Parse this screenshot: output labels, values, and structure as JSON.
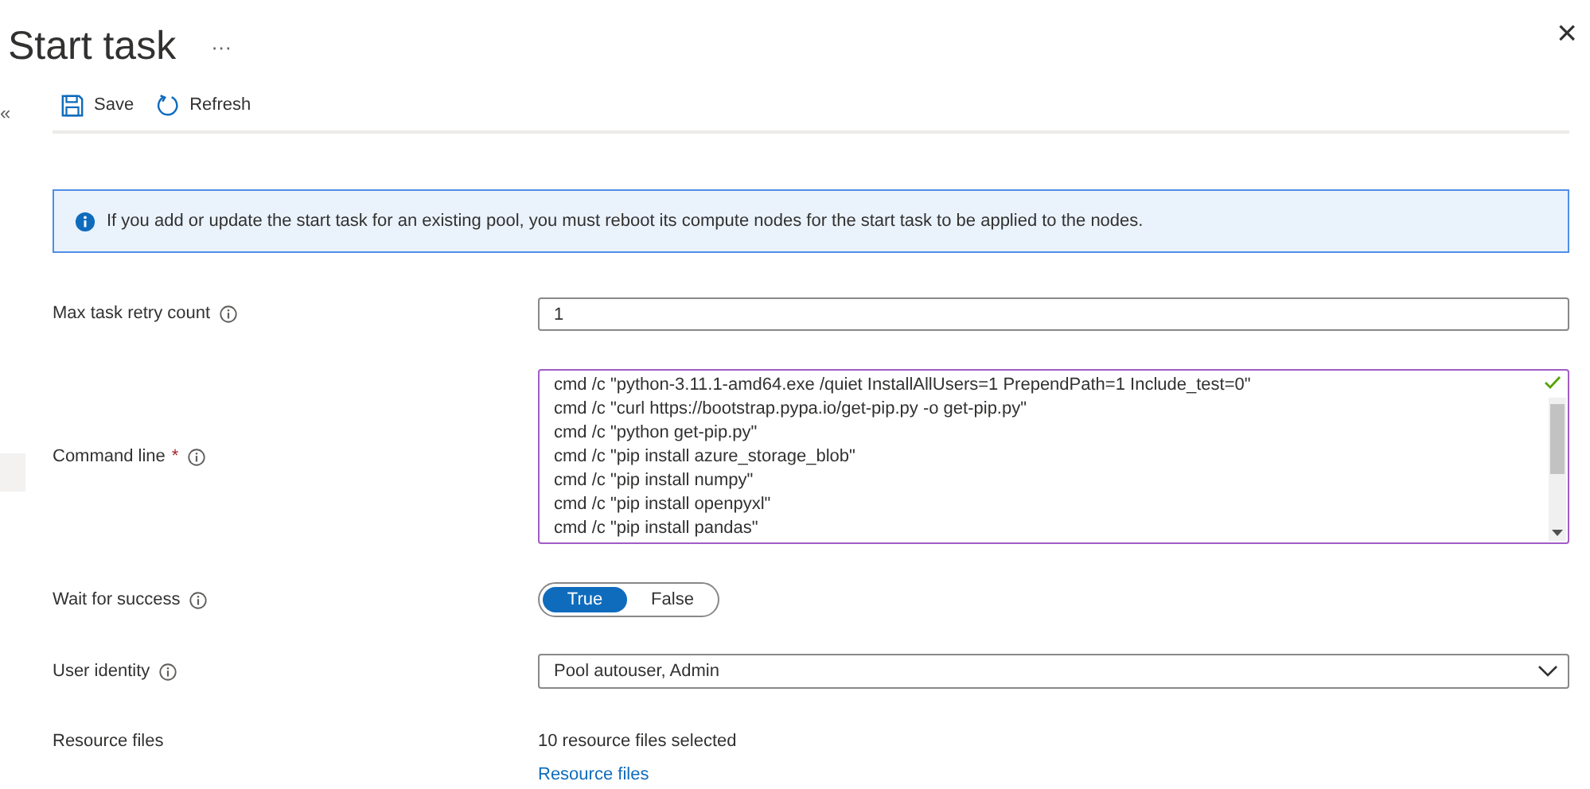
{
  "header": {
    "title": "Start task",
    "more": "···",
    "close": "×"
  },
  "sidebar": {
    "collapse": "«"
  },
  "toolbar": [
    {
      "label": "Save",
      "kind": "save"
    },
    {
      "label": "Refresh",
      "kind": "refresh"
    }
  ],
  "info": "If you add or update the start task for an existing pool, you must reboot its compute nodes for the start task to be applied to the nodes.",
  "fields": [
    {
      "label": "Max task retry count",
      "kind": "text",
      "info": true,
      "value": "1"
    },
    {
      "label": "Command line",
      "kind": "multiline",
      "info": true,
      "required_mark": "*",
      "valid": true,
      "lines": [
        "cmd /c \"python-3.11.1-amd64.exe /quiet InstallAllUsers=1 PrependPath=1 Include_test=0\"",
        "cmd /c \"curl https://bootstrap.pypa.io/get-pip.py -o get-pip.py\"",
        "cmd /c \"python get-pip.py\"",
        "cmd /c \"pip install azure_storage_blob\"",
        "cmd /c \"pip install numpy\"",
        "cmd /c \"pip install openpyxl\"",
        "cmd /c \"pip install pandas\""
      ]
    },
    {
      "label": "Wait for success",
      "kind": "toggle",
      "info": true,
      "options": [
        {
          "label": "True",
          "selected": true
        },
        {
          "label": "False",
          "selected": false
        }
      ]
    },
    {
      "label": "User identity",
      "kind": "select",
      "info": true,
      "value": "Pool autouser, Admin"
    },
    {
      "label": "Resource files",
      "kind": "files",
      "info": false,
      "summary": "10 resource files selected",
      "link": "Resource files"
    }
  ]
}
